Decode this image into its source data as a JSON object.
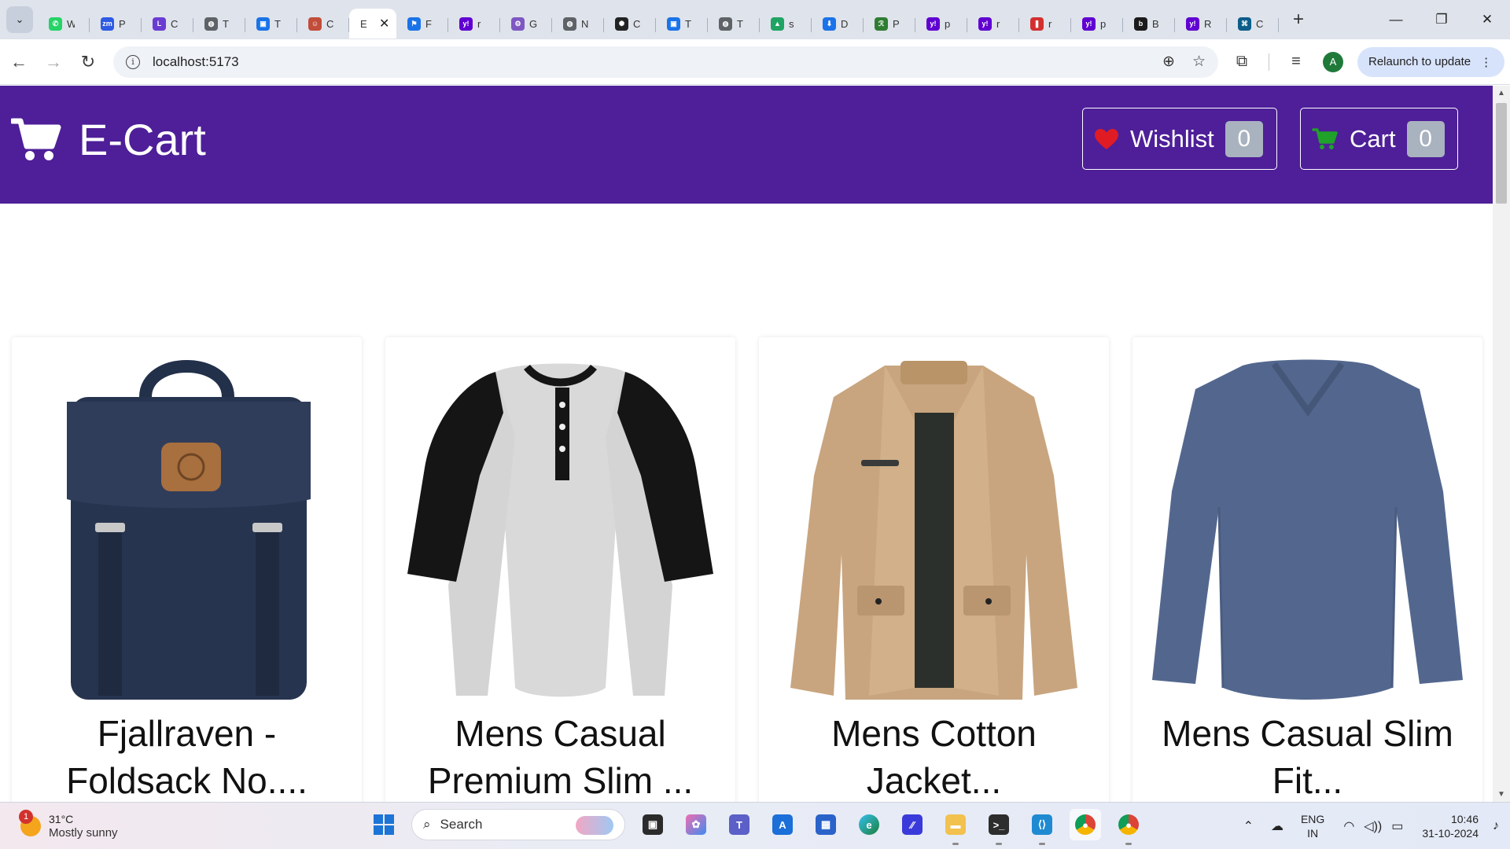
{
  "browser": {
    "tabs": [
      {
        "letter": "W",
        "color": "#25d366",
        "glyph": "✆",
        "active": false
      },
      {
        "letter": "P",
        "color": "#2d5be3",
        "glyph": "zm",
        "active": false
      },
      {
        "letter": "C",
        "color": "#6a3bd3",
        "glyph": "L",
        "active": false
      },
      {
        "letter": "T",
        "color": "#5f6368",
        "glyph": "◍",
        "active": false
      },
      {
        "letter": "T",
        "color": "#1a73e8",
        "glyph": "▣",
        "active": false
      },
      {
        "letter": "C",
        "color": "#c24d3a",
        "glyph": "☺",
        "active": false
      },
      {
        "letter": "E",
        "color": "#ffffff",
        "glyph": "",
        "active": true
      },
      {
        "letter": "F",
        "color": "#1a73e8",
        "glyph": "⚑",
        "active": false
      },
      {
        "letter": "r",
        "color": "#6001d2",
        "glyph": "y!",
        "active": false
      },
      {
        "letter": "G",
        "color": "#7e57c2",
        "glyph": "⚙",
        "active": false
      },
      {
        "letter": "N",
        "color": "#5f6368",
        "glyph": "◍",
        "active": false
      },
      {
        "letter": "C",
        "color": "#222222",
        "glyph": "✺",
        "active": false
      },
      {
        "letter": "T",
        "color": "#1a73e8",
        "glyph": "▣",
        "active": false
      },
      {
        "letter": "T",
        "color": "#5f6368",
        "glyph": "◍",
        "active": false
      },
      {
        "letter": "s",
        "color": "#1fa463",
        "glyph": "▲",
        "active": false
      },
      {
        "letter": "D",
        "color": "#1a73e8",
        "glyph": "⬇",
        "active": false
      },
      {
        "letter": "P",
        "color": "#2e7d32",
        "glyph": "ℛ",
        "active": false
      },
      {
        "letter": "p",
        "color": "#6001d2",
        "glyph": "y!",
        "active": false
      },
      {
        "letter": "r",
        "color": "#6001d2",
        "glyph": "y!",
        "active": false
      },
      {
        "letter": "r",
        "color": "#d32f2f",
        "glyph": "❚",
        "active": false
      },
      {
        "letter": "p",
        "color": "#6001d2",
        "glyph": "y!",
        "active": false
      },
      {
        "letter": "B",
        "color": "#1b1b1b",
        "glyph": "b",
        "active": false
      },
      {
        "letter": "R",
        "color": "#6001d2",
        "glyph": "y!",
        "active": false
      },
      {
        "letter": "C",
        "color": "#0b5d8a",
        "glyph": "⌘",
        "active": false
      }
    ],
    "active_tab_close": "✕",
    "new_tab": "+",
    "window": {
      "minimize": "—",
      "restore": "❐",
      "close": "✕"
    },
    "address": "localhost:5173",
    "relaunch_label": "Relaunch to update",
    "profile_initial": "A"
  },
  "app": {
    "brand": "E-Cart",
    "wishlist_label": "Wishlist",
    "wishlist_count": "0",
    "cart_label": "Cart",
    "cart_count": "0",
    "colors": {
      "navbar": "#4e1f98",
      "heart": "#e01b24",
      "cart_icon": "#1fa12a"
    }
  },
  "products": [
    {
      "title_line1": "Fjallraven -",
      "title_line2": "Foldsack No....",
      "image": "backpack"
    },
    {
      "title_line1": "Mens Casual",
      "title_line2": "Premium Slim ...",
      "image": "raglan-tshirt"
    },
    {
      "title_line1": "Mens Cotton",
      "title_line2": "Jacket...",
      "image": "cotton-jacket"
    },
    {
      "title_line1": "Mens Casual Slim",
      "title_line2": "Fit...",
      "image": "longsleeve-tshirt"
    }
  ],
  "taskbar": {
    "weather_temp": "31°C",
    "weather_cond": "Mostly sunny",
    "weather_alert": "1",
    "search_label": "Search",
    "lang_top": "ENG",
    "lang_bottom": "IN",
    "time": "10:46",
    "date": "31-10-2024"
  }
}
